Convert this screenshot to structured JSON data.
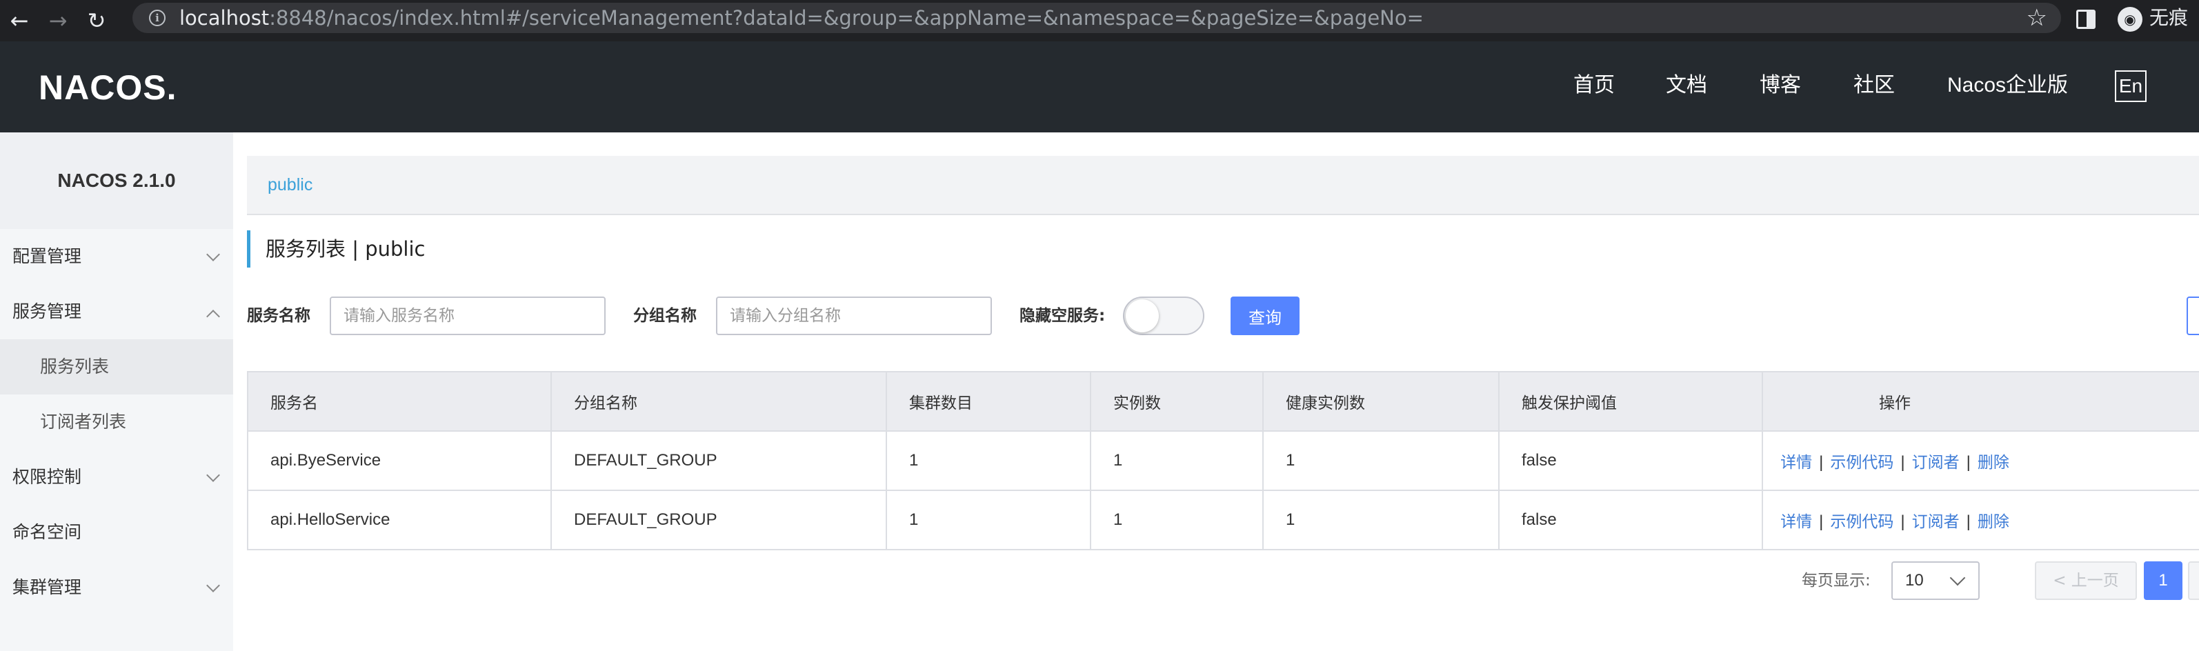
{
  "browser": {
    "url_host": "localhost",
    "url_rest": ":8848/nacos/index.html#/serviceManagement?dataId=&group=&appName=&namespace=&pageSize=&pageNo=",
    "profile_label": "无痕",
    "icons": [
      "back-icon",
      "forward-icon",
      "reload-icon",
      "info-icon",
      "star-icon",
      "sidepanel-icon",
      "incognito-icon"
    ]
  },
  "header": {
    "logo": "NACOS.",
    "nav": [
      "首页",
      "文档",
      "博客",
      "社区",
      "Nacos企业版"
    ],
    "lang_button": "En"
  },
  "sidebar": {
    "version_title": "NACOS 2.1.0",
    "items": [
      {
        "label": "配置管理",
        "arrow": "down"
      },
      {
        "label": "服务管理",
        "arrow": "up"
      },
      {
        "label": "服务列表",
        "sub": true,
        "active": true
      },
      {
        "label": "订阅者列表",
        "sub": true
      },
      {
        "label": "权限控制",
        "arrow": "down"
      },
      {
        "label": "命名空间"
      },
      {
        "label": "集群管理",
        "arrow": "down"
      }
    ]
  },
  "namespace_bar": {
    "current": "public"
  },
  "page_title": "服务列表  |  public",
  "filters": {
    "service_name_label": "服务名称",
    "service_name_placeholder": "请输入服务名称",
    "group_name_label": "分组名称",
    "group_name_placeholder": "请输入分组名称",
    "hide_empty_label": "隐藏空服务:",
    "hide_empty_on": false,
    "query_button": "查询"
  },
  "table": {
    "columns": [
      "服务名",
      "分组名称",
      "集群数目",
      "实例数",
      "健康实例数",
      "触发保护阈值",
      "操作"
    ],
    "rows": [
      {
        "service": "api.ByeService",
        "group": "DEFAULT_GROUP",
        "clusters": "1",
        "instances": "1",
        "healthy": "1",
        "threshold": "false"
      },
      {
        "service": "api.HelloService",
        "group": "DEFAULT_GROUP",
        "clusters": "1",
        "instances": "1",
        "healthy": "1",
        "threshold": "false"
      }
    ],
    "ops": [
      "详情",
      "示例代码",
      "订阅者",
      "删除"
    ],
    "ops_separator": "|"
  },
  "pagination": {
    "page_size_label": "每页显示:",
    "page_size": "10",
    "prev": "< 上一页",
    "current_page": "1"
  },
  "colors": {
    "header_bg": "#252a2f",
    "accent": "#5584ff",
    "link": "#3d7bd6",
    "namespace_link": "#3ba1d9"
  }
}
